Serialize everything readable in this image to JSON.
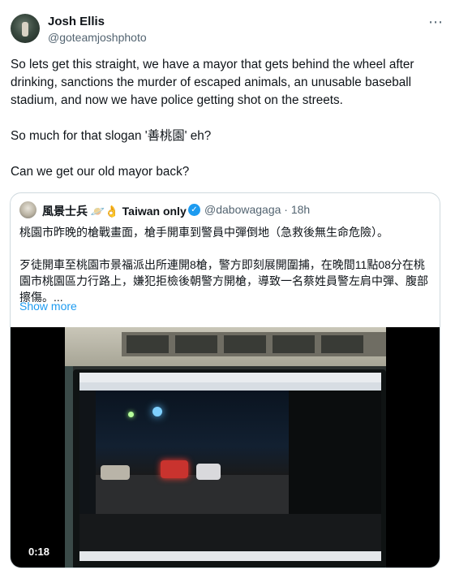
{
  "author": {
    "name": "Josh Ellis",
    "handle": "@goteamjoshphoto"
  },
  "menu_icon": "more-horizontal-icon",
  "tweet": {
    "paragraphs": [
      "So lets get this straight, we have a mayor that gets behind the wheel after drinking, sanctions the murder of escaped animals, an unusable baseball stadium, and now we have police getting shot on the streets.",
      "So much for that slogan '善桃園' eh?",
      "Can we get our old mayor back?"
    ]
  },
  "quote": {
    "name": "風景士兵 🪐👌 Taiwan only",
    "handle_time": "@dabowagaga · 18h",
    "paragraphs": [
      "桃園市昨晚的槍戰畫面，槍手開車到警員中彈倒地（急救後無生命危險）。",
      "歹徒開車至桃園市景福派出所連開8槍，警方即刻展開圍捕，在晚間11點08分在桃園市桃園區力行路上，嫌犯拒檢後朝警方開槍，導致一名蔡姓員警左肩中彈、腹部擦傷。..."
    ],
    "show_more": "Show more",
    "video": {
      "timestamp": "0:18"
    }
  },
  "colors": {
    "link": "#1d9bf0",
    "secondary_text": "#536471",
    "border": "#cfd9de"
  }
}
